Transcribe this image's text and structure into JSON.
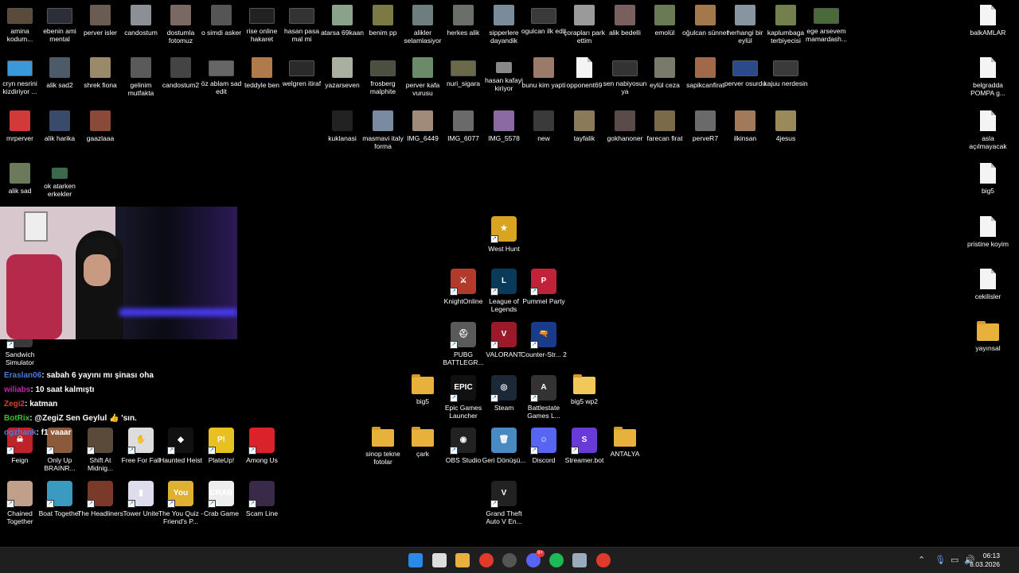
{
  "desktop": {
    "icons": [
      {
        "label": "amina kodum...",
        "kind": "vid",
        "col": "#5a4a3a"
      },
      {
        "label": "ebenin ami mental",
        "kind": "vid",
        "col": "#2c2f3a"
      },
      {
        "label": "perver isler",
        "kind": "img",
        "col": "#6a5c52"
      },
      {
        "label": "candostum",
        "kind": "img",
        "col": "#8d8f97"
      },
      {
        "label": "dostumla fotomuz",
        "kind": "img",
        "col": "#7a6864"
      },
      {
        "label": "o simdi asker",
        "kind": "img",
        "col": "#555"
      },
      {
        "label": "rise online hakaret",
        "kind": "vid",
        "col": "#222"
      },
      {
        "label": "hasan pasa mal mi",
        "kind": "vid",
        "col": "#333"
      },
      {
        "label": "atarsa 69kaan",
        "kind": "img",
        "col": "#8aa28c"
      },
      {
        "label": "benim pp",
        "kind": "img",
        "col": "#7c7a44"
      },
      {
        "label": "alikler selamlasiyor",
        "kind": "img",
        "col": "#6e7d80"
      },
      {
        "label": "herkes alik",
        "kind": "img",
        "col": "#6b6f6a"
      },
      {
        "label": "sipperlere dayandik",
        "kind": "img",
        "col": "#7a8c9b"
      },
      {
        "label": "ogulcan ilk edit",
        "kind": "vid",
        "col": "#3a3a3a"
      },
      {
        "label": "çorapları park ettim",
        "kind": "img",
        "col": "#9a9a9a"
      },
      {
        "label": "alik bedelli",
        "kind": "img",
        "col": "#7a5f5f"
      },
      {
        "label": "emolül",
        "kind": "img",
        "col": "#6a7a55"
      },
      {
        "label": "oğulcan sünnet",
        "kind": "img",
        "col": "#a2784c"
      },
      {
        "label": "herhangi bir eylül",
        "kind": "img",
        "col": "#8894a0"
      },
      {
        "label": "kaplumbaga terbiyecisi",
        "kind": "img",
        "col": "#73804d"
      },
      {
        "label": "ege arsevem mamardash...",
        "kind": "vid",
        "col": "#4a6a3a"
      },
      {
        "label": "cryn nesrini kizdiriyor ...",
        "kind": "vid",
        "col": "#3a9ad9"
      },
      {
        "label": "alik sad2",
        "kind": "img",
        "col": "#4c5a6a"
      },
      {
        "label": "shrek fiona",
        "kind": "img",
        "col": "#9a8a6a"
      },
      {
        "label": "gelinim mutfakta",
        "kind": "img",
        "col": "#5a5a5a"
      },
      {
        "label": "candostum2",
        "kind": "img",
        "col": "#444"
      },
      {
        "label": "öz ablam sad edit",
        "kind": "vid",
        "col": "#666"
      },
      {
        "label": "teddyle ben",
        "kind": "img",
        "col": "#b07a4a"
      },
      {
        "label": "welgren itiraf",
        "kind": "vid",
        "col": "#2a2a2a"
      },
      {
        "label": "yazarseven",
        "kind": "img",
        "col": "#aab0a0"
      },
      {
        "label": "frosberg malphite",
        "kind": "vid",
        "col": "#4a5040"
      },
      {
        "label": "perver kafa vurusu",
        "kind": "img",
        "col": "#6a8a6a"
      },
      {
        "label": "nuri_sigara",
        "kind": "vid",
        "col": "#6a6a4a"
      },
      {
        "label": "hasan kafayi kiriyor",
        "kind": "small",
        "col": "#888"
      },
      {
        "label": "bunu kim yapti",
        "kind": "img",
        "col": "#9a7a6a"
      },
      {
        "label": "opponent69",
        "kind": "doc",
        "col": "#fff"
      },
      {
        "label": "sen nabiyosun ya",
        "kind": "vid",
        "col": "#333"
      },
      {
        "label": "eylül ceza",
        "kind": "img",
        "col": "#7a7a6a"
      },
      {
        "label": "sapikcanfirat",
        "kind": "img",
        "col": "#a06a4a"
      },
      {
        "label": "perver osurdu",
        "kind": "vid",
        "col": "#2a4a8a"
      },
      {
        "label": "kajuu nerdesin",
        "kind": "vid",
        "col": "#3a3a3a"
      },
      {
        "label": "mrperver",
        "kind": "img",
        "col": "#d23a3a"
      },
      {
        "label": "alik harika",
        "kind": "img",
        "col": "#3a4a6a"
      },
      {
        "label": "gaazlaaa",
        "kind": "img",
        "col": "#8a4a3a"
      },
      {
        "label": "kuklanasi",
        "kind": "img",
        "col": "#222"
      },
      {
        "label": "masmavi italy forma",
        "kind": "img",
        "col": "#7a8aa0"
      },
      {
        "label": "IMG_6449",
        "kind": "img",
        "col": "#a08a7a"
      },
      {
        "label": "IMG_6077",
        "kind": "img",
        "col": "#6a6a6a"
      },
      {
        "label": "IMG_5578",
        "kind": "img",
        "col": "#8a6aa0"
      },
      {
        "label": "new",
        "kind": "img",
        "col": "#3a3a3a"
      },
      {
        "label": "tayfalik",
        "kind": "img",
        "col": "#8a7a5a"
      },
      {
        "label": "gokhanoner",
        "kind": "img",
        "col": "#5a4a4a"
      },
      {
        "label": "farecan firat",
        "kind": "img",
        "col": "#7a6a4a"
      },
      {
        "label": "perveR7",
        "kind": "img",
        "col": "#6a6a6a"
      },
      {
        "label": "ilkinsan",
        "kind": "img",
        "col": "#a07a5a"
      },
      {
        "label": "4jesus",
        "kind": "img",
        "col": "#9a8a5a"
      },
      {
        "label": "alik sad",
        "kind": "img",
        "col": "#6a7a5a"
      },
      {
        "label": "ok atarken erkekler",
        "kind": "small",
        "col": "#3a6a4a"
      },
      {
        "label": "West Hunt",
        "kind": "app",
        "col": "#d9a420",
        "glyph": "★",
        "sc": true
      },
      {
        "label": "KnightOnline",
        "kind": "app",
        "col": "#b23a2a",
        "glyph": "⚔",
        "sc": true
      },
      {
        "label": "League of Legends",
        "kind": "app",
        "col": "#0a3a5a",
        "glyph": "L",
        "sc": true
      },
      {
        "label": "Pummel Party",
        "kind": "app",
        "col": "#c0223a",
        "glyph": "P",
        "sc": true
      },
      {
        "label": "PUBG BATTLEGR...",
        "kind": "app",
        "col": "#5a5a5a",
        "glyph": "⛑",
        "sc": true
      },
      {
        "label": "VALORANT",
        "kind": "app",
        "col": "#9a1a2a",
        "glyph": "V",
        "sc": true
      },
      {
        "label": "Counter-Str... 2",
        "kind": "app",
        "col": "#1a3a8a",
        "glyph": "🔫",
        "sc": true
      },
      {
        "label": "big5",
        "kind": "folder",
        "col": "#e8b13c"
      },
      {
        "label": "Epic Games Launcher",
        "kind": "app",
        "col": "#111",
        "glyph": "EPIC",
        "sc": true
      },
      {
        "label": "Steam",
        "kind": "app",
        "col": "#1b2838",
        "glyph": "◎",
        "sc": true
      },
      {
        "label": "Battlestate Games L...",
        "kind": "app",
        "col": "#333",
        "glyph": "A",
        "sc": true
      },
      {
        "label": "big5 wp2",
        "kind": "folder",
        "col": "#f2c85a"
      },
      {
        "label": "sinop tekne fotolar",
        "kind": "folder",
        "col": "#e8b13c"
      },
      {
        "label": "çark",
        "kind": "folder",
        "col": "#e8b13c"
      },
      {
        "label": "OBS Studio",
        "kind": "app",
        "col": "#222",
        "glyph": "◉",
        "sc": true
      },
      {
        "label": "Geri Dönüşü...",
        "kind": "app",
        "col": "#4a8ac0",
        "glyph": "🗑",
        "sc": false
      },
      {
        "label": "Discord",
        "kind": "app",
        "col": "#5865f2",
        "glyph": "☺",
        "sc": true
      },
      {
        "label": "Streamer.bot",
        "kind": "app",
        "col": "#6a3ad9",
        "glyph": "S",
        "sc": true
      },
      {
        "label": "ANTALYA",
        "kind": "folder",
        "col": "#e8b13c"
      },
      {
        "label": "Grand Theft Auto V En...",
        "kind": "app",
        "col": "#222",
        "glyph": "V",
        "sc": true
      },
      {
        "label": "balkAMLAR",
        "kind": "doc",
        "col": "#fff"
      },
      {
        "label": "belgradda POMPA g...",
        "kind": "doc",
        "col": "#fff"
      },
      {
        "label": "asla açılmayacak",
        "kind": "doc",
        "col": "#fff"
      },
      {
        "label": "big5",
        "kind": "doc",
        "col": "#fff"
      },
      {
        "label": "pristine koyim",
        "kind": "doc",
        "col": "#fff"
      },
      {
        "label": "cekilisler",
        "kind": "doc",
        "col": "#fff"
      },
      {
        "label": "yayınsal",
        "kind": "folder",
        "col": "#e8b13c"
      },
      {
        "label": "Sandwich Simulator",
        "kind": "app",
        "col": "#3a3a3a",
        "glyph": "",
        "sc": true
      },
      {
        "label": "Feign",
        "kind": "app",
        "col": "#c0222a",
        "glyph": "☠",
        "sc": true
      },
      {
        "label": "Only Up BRAINR...",
        "kind": "app",
        "col": "#8a5a3a",
        "glyph": "",
        "sc": true
      },
      {
        "label": "Shift At Midnig...",
        "kind": "app",
        "col": "#5a4a3a",
        "glyph": "",
        "sc": true
      },
      {
        "label": "Free For Fall",
        "kind": "app",
        "col": "#ddd",
        "glyph": "✋",
        "sc": true
      },
      {
        "label": "Haunted Heist",
        "kind": "app",
        "col": "#111",
        "glyph": "◆",
        "sc": true
      },
      {
        "label": "PlateUp!",
        "kind": "app",
        "col": "#e8c020",
        "glyph": "P!",
        "sc": true
      },
      {
        "label": "Among Us",
        "kind": "app",
        "col": "#d9222a",
        "glyph": "",
        "sc": true
      },
      {
        "label": "Chained Together",
        "kind": "app",
        "col": "#c0a08a",
        "glyph": "",
        "sc": true
      },
      {
        "label": "Boat Together",
        "kind": "app",
        "col": "#3a9ac0",
        "glyph": "",
        "sc": true
      },
      {
        "label": "The Headliners",
        "kind": "app",
        "col": "#7a3a2a",
        "glyph": "",
        "sc": true
      },
      {
        "label": "Tower Unite",
        "kind": "app",
        "col": "#dde",
        "glyph": "▮",
        "sc": true
      },
      {
        "label": "The You Quiz - Friend's P...",
        "kind": "app",
        "col": "#e0b030",
        "glyph": "You",
        "sc": true
      },
      {
        "label": "Crab Game",
        "kind": "app",
        "col": "#eee",
        "glyph": "CRAB",
        "sc": true
      },
      {
        "label": "Scam Line",
        "kind": "app",
        "col": "#3a2a4a",
        "glyph": "",
        "sc": true
      }
    ]
  },
  "chat": {
    "messages": [
      {
        "user": "Eraslan06",
        "user_color": "#4a7ad9",
        "text": ": sabah 6 yayını mı şinası oha"
      },
      {
        "user": "wiliabs",
        "user_color": "#c02aa0",
        "text": ": 10 saat kalmıştı"
      },
      {
        "user": "Zegi2",
        "user_color": "#d9402a",
        "text": ": katman"
      },
      {
        "user": "BotRix",
        "user_color": "#3ac03a",
        "text": ": @ZegiZ Sen Geylul 👍 'sın."
      },
      {
        "user": "ogzhank",
        "user_color": "#4a7ad9",
        "text": ": f1 vaaar"
      }
    ]
  },
  "taskbar": {
    "icons": [
      {
        "name": "windows-start-icon",
        "col": "#2a8ae8"
      },
      {
        "name": "search-icon",
        "col": "#ddd"
      },
      {
        "name": "file-explorer-icon",
        "col": "#e8b13c"
      },
      {
        "name": "chrome-icon",
        "col": "#e23a2a"
      },
      {
        "name": "obs-taskbar-icon",
        "col": "#555"
      },
      {
        "name": "discord-taskbar-icon",
        "col": "#5865f2"
      },
      {
        "name": "spotify-icon",
        "col": "#1db954"
      },
      {
        "name": "steam-taskbar-icon",
        "col": "#9ab"
      },
      {
        "name": "chrome-2-icon",
        "col": "#e23a2a"
      }
    ],
    "discord_badge": "9+",
    "time": "06:13",
    "date": "8.03.2026"
  }
}
